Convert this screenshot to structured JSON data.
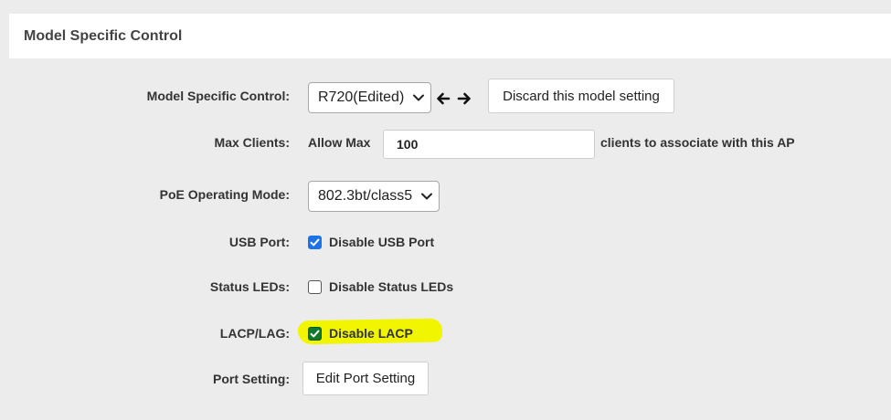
{
  "panel": {
    "title": "Model Specific Control"
  },
  "rows": {
    "model": {
      "label": "Model Specific Control:",
      "selected": "R720(Edited)",
      "discard_label": "Discard this model setting"
    },
    "max_clients": {
      "label": "Max Clients:",
      "prefix": "Allow Max",
      "value": "100",
      "suffix": "clients to associate with this AP"
    },
    "poe": {
      "label": "PoE Operating Mode:",
      "selected": "802.3bt/class5"
    },
    "usb": {
      "label": "USB Port:",
      "checkbox_label": "Disable USB Port",
      "checked": true
    },
    "status_leds": {
      "label": "Status LEDs:",
      "checkbox_label": "Disable Status LEDs",
      "checked": false
    },
    "lacp": {
      "label": "LACP/LAG:",
      "checkbox_label": "Disable LACP",
      "checked": true
    },
    "port_setting": {
      "label": "Port Setting:",
      "button_label": "Edit Port Setting"
    }
  },
  "colors": {
    "checkbox_checked": "#1a73e8",
    "highlight": "#f2f500"
  },
  "icons": {
    "prev": "arrow-left-icon",
    "next": "arrow-right-icon",
    "dropdown": "chevron-down-icon",
    "check": "checkmark-icon"
  }
}
